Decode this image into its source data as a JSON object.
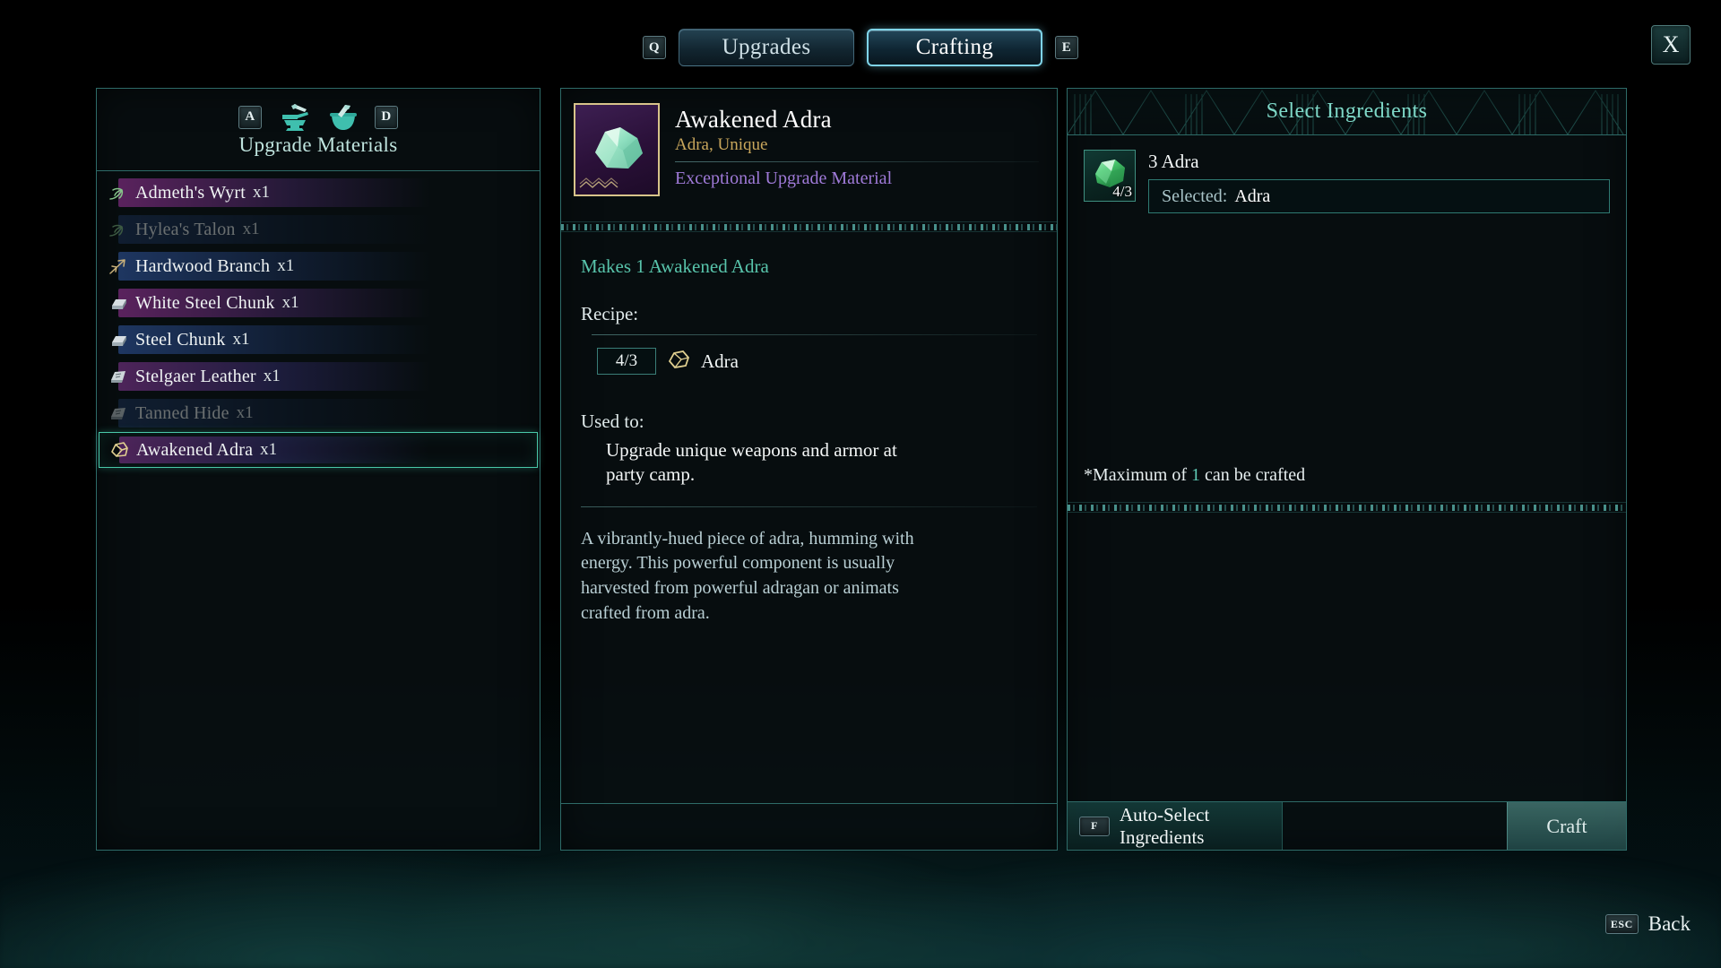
{
  "window": {
    "close_label": "X",
    "back_key": "ESC",
    "back_label": "Back"
  },
  "tabs": {
    "left_key": "Q",
    "right_key": "E",
    "items": [
      {
        "label": "Upgrades",
        "active": false
      },
      {
        "label": "Crafting",
        "active": true
      }
    ]
  },
  "left_panel": {
    "prev_key": "A",
    "next_key": "D",
    "category_icons": [
      "anvil-icon",
      "mortar-pestle-icon"
    ],
    "title": "Upgrade Materials",
    "items": [
      {
        "name": "Admeth's Wyrt",
        "qty": "x1",
        "icon": "herb-icon",
        "style": "grad-purple",
        "dim": false,
        "selected": false
      },
      {
        "name": "Hylea's Talon",
        "qty": "x1",
        "icon": "herb-icon",
        "style": "grad-blue",
        "dim": true,
        "selected": false
      },
      {
        "name": "Hardwood Branch",
        "qty": "x1",
        "icon": "branch-icon",
        "style": "grad-blue",
        "dim": false,
        "selected": false
      },
      {
        "name": "White Steel Chunk",
        "qty": "x1",
        "icon": "ingot-icon",
        "style": "grad-purple",
        "dim": false,
        "selected": false
      },
      {
        "name": "Steel Chunk",
        "qty": "x1",
        "icon": "ingot-icon",
        "style": "grad-blue",
        "dim": false,
        "selected": false
      },
      {
        "name": "Stelgaer Leather",
        "qty": "x1",
        "icon": "leather-icon",
        "style": "grad-mixed",
        "dim": false,
        "selected": false
      },
      {
        "name": "Tanned Hide",
        "qty": "x1",
        "icon": "leather-icon",
        "style": "grad-blue",
        "dim": true,
        "selected": false
      },
      {
        "name": "Awakened Adra",
        "qty": "x1",
        "icon": "adra-icon",
        "style": "grad-mixed",
        "dim": false,
        "selected": true
      }
    ]
  },
  "detail_panel": {
    "item_name": "Awakened Adra",
    "item_subtype": "Adra, Unique",
    "item_rarity": "Exceptional Upgrade Material",
    "item_icon": "green-crystal-icon",
    "makes_line": "Makes 1 Awakened Adra",
    "recipe_label": "Recipe:",
    "recipe": [
      {
        "qty": "4/3",
        "ingredient": "Adra",
        "icon": "adra-icon"
      }
    ],
    "used_to_label": "Used to:",
    "used_to_text": "Upgrade unique weapons and armor at party camp.",
    "description": "A vibrantly-hued piece of adra, humming with energy. This powerful component is usually harvested from powerful adragan or animats crafted from adra."
  },
  "ingredients_panel": {
    "title": "Select Ingredients",
    "slots": [
      {
        "requirement": "3 Adra",
        "count": "4/3",
        "icon": "green-gem-icon",
        "selected_label": "Selected:",
        "selected_value": "Adra"
      }
    ],
    "max_note_prefix": "*Maximum of ",
    "max_note_number": "1",
    "max_note_suffix": " can be crafted",
    "autoselect_key": "F",
    "autoselect_label": "Auto-Select Ingredients",
    "craft_label": "Craft"
  },
  "colors": {
    "accent_teal": "#5fc9b4",
    "panel_border": "#2e6b68",
    "tab_active_border": "#7fd4e8",
    "gold": "#c9a75c",
    "rarity_purple": "#9f7ad8"
  }
}
